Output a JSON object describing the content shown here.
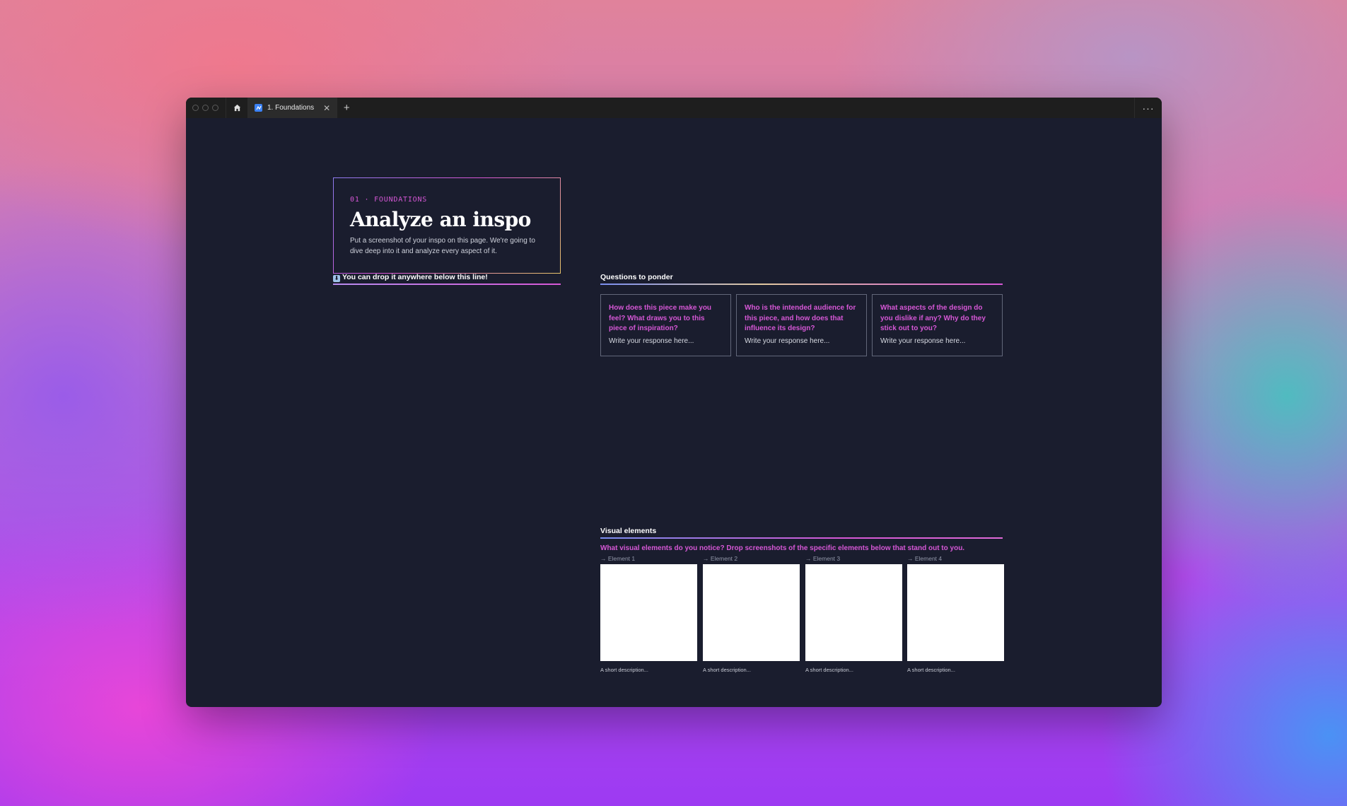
{
  "window": {
    "tab_title": "1. Foundations",
    "tab_close": "✕",
    "add_tab": "+",
    "more": "···"
  },
  "hero": {
    "eyebrow": "01 · FOUNDATIONS",
    "title": "Analyze an inspo",
    "description": "Put a screenshot of your inspo on this page. We're going to dive deep into it and analyze every aspect of it."
  },
  "drop_zone": {
    "icon": "⬇",
    "label": "You can drop it anywhere below this line!"
  },
  "questions": {
    "heading": "Questions to ponder",
    "items": [
      {
        "question": "How does this piece make you feel? What draws you to this piece of inspiration?",
        "answer": "Write your response here..."
      },
      {
        "question": "Who is the intended audience for this piece, and how does that influence its design?",
        "answer": "Write your response here..."
      },
      {
        "question": "What aspects of the design do you dislike if any? Why do they stick out to you?",
        "answer": "Write your response here..."
      }
    ]
  },
  "visual_elements": {
    "heading": "Visual elements",
    "prompt": "What visual elements do you notice? Drop screenshots of the specific elements below that stand out to you.",
    "items": [
      {
        "label": "→ Element 1",
        "description": "A short description..."
      },
      {
        "label": "→ Element 2",
        "description": "A short description..."
      },
      {
        "label": "→ Element 3",
        "description": "A short description..."
      },
      {
        "label": "→ Element 4",
        "description": "A short description..."
      }
    ]
  },
  "colors": {
    "accent": "#d657d6",
    "background": "#1a1d2e",
    "titlebar": "#1e1e1e"
  },
  "icons": {
    "home": "home-icon",
    "tab": "whiteboard-icon",
    "more": "more-horizontal-icon"
  }
}
